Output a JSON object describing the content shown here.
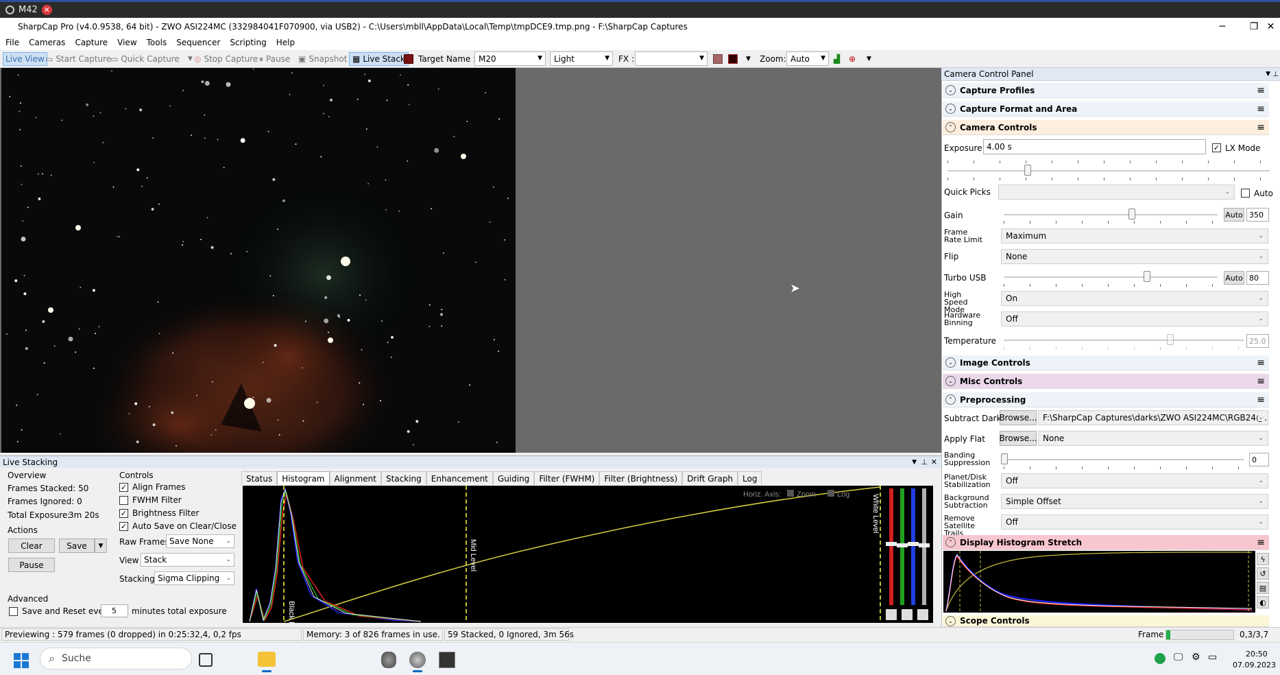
{
  "tab": {
    "label": "M42"
  },
  "window": {
    "title": "SharpCap Pro (v4.0.9538, 64 bit) - ZWO ASI224MC (332984041F070900, via USB2) - C:\\Users\\mbll\\AppData\\Local\\Temp\\tmpDCE9.tmp.png - F:\\SharpCap Captures"
  },
  "menu": [
    "File",
    "Cameras",
    "Capture",
    "View",
    "Tools",
    "Sequencer",
    "Scripting",
    "Help"
  ],
  "toolbar": {
    "live_view": "Live View",
    "start_capture": "Start Capture",
    "quick_capture": "Quick Capture",
    "stop_capture": "Stop Capture",
    "pause": "Pause",
    "snapshot": "Snapshot",
    "live_stack": "Live Stack",
    "target_label": "Target Name :",
    "target_value": "M20",
    "frame_type": "Light",
    "fx_label": "FX :",
    "fx_value": "",
    "zoom_label": "Zoom:",
    "zoom_value": "Auto"
  },
  "live_stacking": {
    "title": "Live Stacking",
    "overview_title": "Overview",
    "frames_stacked": "Frames Stacked: 50",
    "frames_ignored": "Frames Ignored: 0",
    "total_exposure": "Total Exposure:",
    "total_exposure_value": "3m 20s",
    "actions_title": "Actions",
    "clear": "Clear",
    "save": "Save",
    "pause": "Pause",
    "advanced_title": "Advanced",
    "save_reset_label": "Save and Reset every",
    "save_reset_value": "5",
    "save_reset_suffix": "minutes total exposure",
    "controls_title": "Controls",
    "align_frames": "Align Frames",
    "fwhm_filter": "FWHM Filter",
    "brightness_filter": "Brightness Filter",
    "auto_save": "Auto Save on Clear/Close",
    "raw_frames_label": "Raw Frames",
    "raw_frames_value": "Save None",
    "view_label": "View",
    "view_value": "Stack",
    "stacking_label": "Stacking",
    "stacking_value": "Sigma Clipping",
    "tabs": [
      "Status",
      "Histogram",
      "Alignment",
      "Stacking",
      "Enhancement",
      "Guiding",
      "Filter (FWHM)",
      "Filter (Brightness)",
      "Drift Graph",
      "Log"
    ],
    "histogram": {
      "horiz_axis": "Horiz. Axis:",
      "zoom": "Zoom",
      "log": "Log",
      "black_level": "Black Level",
      "mid_level": "Mid Level",
      "white_level": "White Level"
    }
  },
  "camera_panel": {
    "title": "Camera Control Panel",
    "sections": {
      "capture_profiles": "Capture Profiles",
      "capture_format": "Capture Format and Area",
      "camera_controls": "Camera Controls",
      "image_controls": "Image Controls",
      "misc_controls": "Misc Controls",
      "preprocessing": "Preprocessing",
      "display_histogram": "Display Histogram Stretch",
      "scope_controls": "Scope Controls"
    },
    "exposure_label": "Exposure",
    "exposure_value": "4.00 s",
    "lx_mode": "LX Mode",
    "quick_picks_label": "Quick Picks",
    "quick_picks_auto": "Auto",
    "gain_label": "Gain",
    "gain_auto": "Auto",
    "gain_value": "350",
    "gain_level": 0.6,
    "frame_rate_label": "Frame Rate Limit",
    "frame_rate_value": "Maximum",
    "flip_label": "Flip",
    "flip_value": "None",
    "turbo_label": "Turbo USB",
    "turbo_auto": "Auto",
    "turbo_value": "80",
    "turbo_level": 0.67,
    "high_speed_label": "High Speed Mode",
    "high_speed_value": "On",
    "hw_binning_label": "Hardware Binning",
    "hw_binning_value": "Off",
    "temperature_label": "Temperature",
    "temperature_value": "25.0",
    "subtract_dark_label": "Subtract Dark",
    "browse": "Browse...",
    "subtract_dark_value": "F:\\SharpCap Captures\\darks\\ZWO ASI224MC\\RGB24@...",
    "apply_flat_label": "Apply Flat",
    "apply_flat_value": "None",
    "banding_label": "Banding Suppression",
    "banding_value": "0",
    "planet_label": "Planet/Disk Stabilization",
    "planet_value": "Off",
    "background_label": "Background Subtraction",
    "background_value": "Simple Offset",
    "remove_trails_label": "Remove Satellite Trails",
    "remove_trails_value": "Off"
  },
  "status": {
    "previewing": "Previewing : 579 frames (0 dropped) in 0:25:32,4, 0,2 fps",
    "memory": "Memory: 3 of 826 frames in use.",
    "stacked": "59 Stacked, 0 Ignored, 3m 56s",
    "frame_label": "Frame :",
    "frame_value": "0,3/3,7"
  },
  "taskbar": {
    "search": "Suche",
    "time": "20:50",
    "date": "07.09.2023"
  }
}
